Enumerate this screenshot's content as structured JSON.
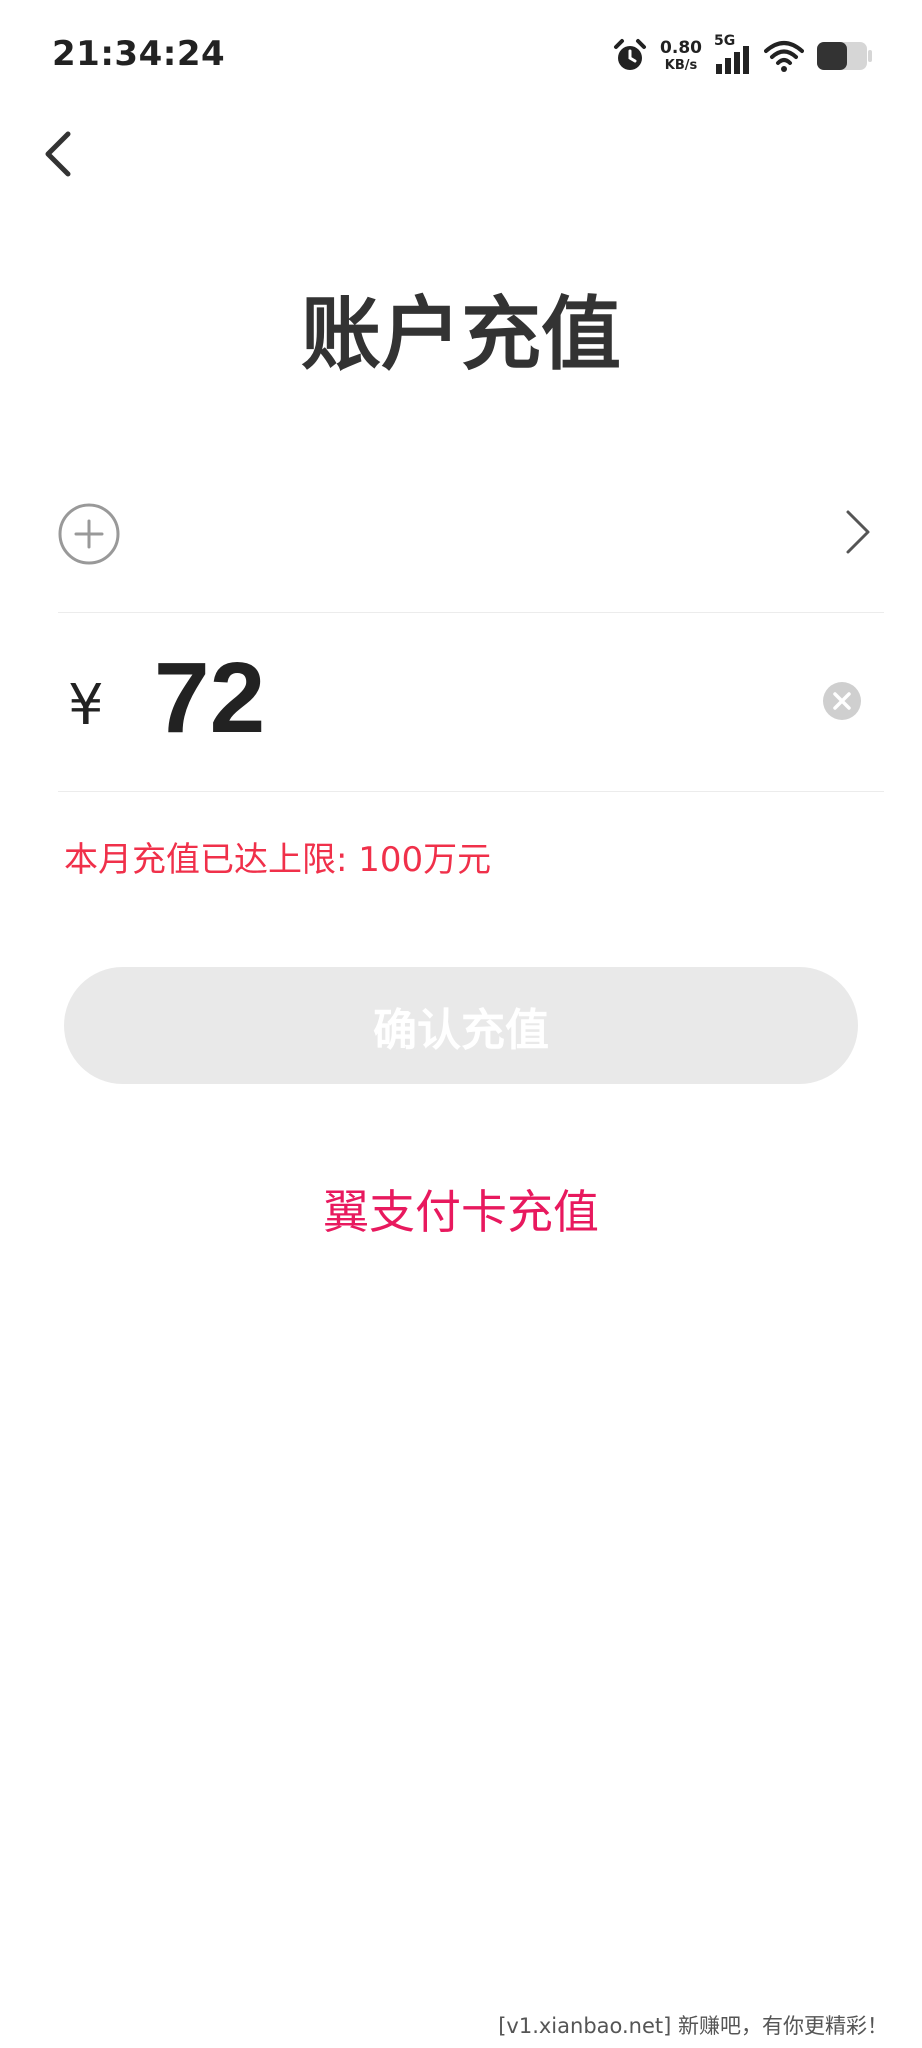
{
  "status_bar": {
    "time": "21:34:24",
    "net_speed_value": "0.80",
    "net_speed_unit": "KB/s",
    "network_type": "5G",
    "icons": [
      "alarm-icon",
      "signal-icon",
      "wifi-icon",
      "battery-icon"
    ],
    "battery_level": 0.4
  },
  "header": {
    "back_icon": "chevron-left-icon",
    "title": "账户充值"
  },
  "card_selector": {
    "add_icon": "plus-circle-icon",
    "chevron_icon": "chevron-right-icon"
  },
  "amount": {
    "currency_symbol": "¥",
    "value": "72",
    "clear_icon": "clear-circle-icon"
  },
  "limit_notice": "本月充值已达上限: 100万元",
  "confirm_button": {
    "label": "确认充值"
  },
  "card_recharge_link": "翼支付卡充值",
  "watermark": "[v1.xianbao.net] 新赚吧，有你更精彩！",
  "colors": {
    "accent_pink": "#e8195e",
    "warning_red": "#f0304a",
    "disabled_button": "#e9e9e9"
  }
}
